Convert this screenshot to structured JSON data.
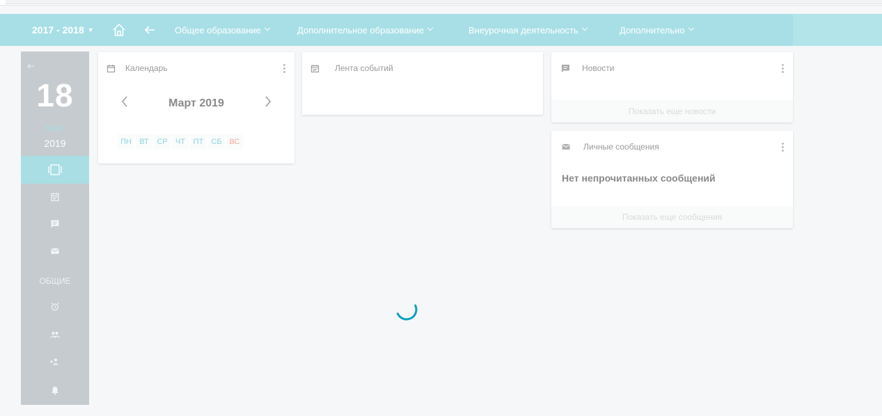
{
  "header": {
    "year": "2017 - 2018",
    "nav": [
      {
        "label": "Общее образование"
      },
      {
        "label": "Дополнительное образование"
      },
      {
        "label": "Внеурочная деятельность"
      },
      {
        "label": "Дополнительно"
      }
    ]
  },
  "sidebar": {
    "day": "18",
    "month": "Март",
    "year": "2019",
    "section_label": "ОБЩИЕ"
  },
  "calendar": {
    "title": "Календарь",
    "month_label": "Март 2019",
    "weekdays": [
      "ПН",
      "ВТ",
      "СР",
      "ЧТ",
      "ПТ",
      "СБ",
      "ВС"
    ]
  },
  "events": {
    "title": "Лента событий"
  },
  "news": {
    "title": "Новости",
    "more": "Показать еще новости"
  },
  "messages": {
    "title": "Личные сообщения",
    "empty": "Нет непрочитанных сообщений",
    "more": "Показать еще сообщения"
  },
  "colors": {
    "header": "#b2e4ea",
    "sidebar": "#c5cbcf",
    "accent": "#0aa0c0",
    "weekend": "#f4a79a"
  }
}
